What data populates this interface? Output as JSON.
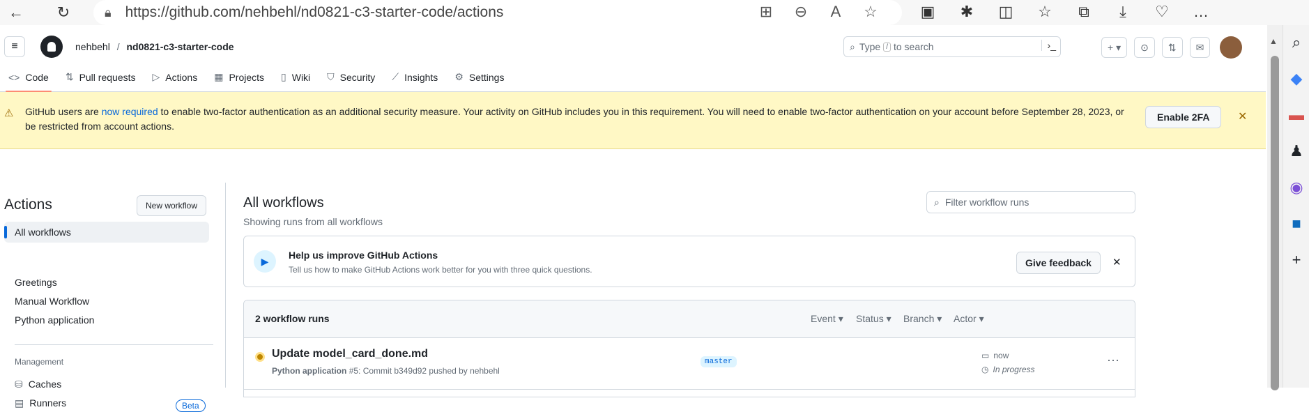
{
  "browser": {
    "url": "https://github.com/nehbehl/nd0821-c3-starter-code/actions"
  },
  "header": {
    "owner": "nehbehl",
    "separator": "/",
    "repo": "nd0821-c3-starter-code",
    "search_prefix": "Type",
    "search_key": "/",
    "search_suffix": "to search",
    "plus": "+ ▾"
  },
  "tabs": [
    {
      "label": "Code",
      "icon": "code-icon"
    },
    {
      "label": "Pull requests",
      "icon": "pull-request-icon"
    },
    {
      "label": "Actions",
      "icon": "play-icon"
    },
    {
      "label": "Projects",
      "icon": "table-icon"
    },
    {
      "label": "Wiki",
      "icon": "book-icon"
    },
    {
      "label": "Security",
      "icon": "shield-icon"
    },
    {
      "label": "Insights",
      "icon": "graph-icon"
    },
    {
      "label": "Settings",
      "icon": "gear-icon"
    }
  ],
  "banner": {
    "text_before": "GitHub users are ",
    "link": "now required",
    "text_after": " to enable two-factor authentication as an additional security measure. Your activity on GitHub includes you in this requirement. You will need to enable two-factor authentication on your account before September 28, 2023, or be restricted from account actions.",
    "button": "Enable 2FA"
  },
  "sidebar": {
    "title": "Actions",
    "new_workflow": "New workflow",
    "all_workflows": "All workflows",
    "workflows": [
      "Greetings",
      "Manual Workflow",
      "Python application"
    ],
    "management_heading": "Management",
    "caches": "Caches",
    "runners": "Runners",
    "runners_badge": "Beta"
  },
  "main": {
    "title": "All workflows",
    "subtitle": "Showing runs from all workflows",
    "filter_placeholder": "Filter workflow runs",
    "feedback": {
      "title": "Help us improve GitHub Actions",
      "desc": "Tell us how to make GitHub Actions work better for you with three quick questions.",
      "button": "Give feedback"
    },
    "runs": {
      "count": "2 workflow runs",
      "filters": [
        "Event ▾",
        "Status ▾",
        "Branch ▾",
        "Actor ▾"
      ],
      "items": [
        {
          "name": "Update model_card_done.md",
          "workflow": "Python application",
          "run": "#5: Commit b349d92 pushed by nehbehl",
          "branch": "master",
          "when": "now",
          "status": "In progress"
        }
      ]
    }
  }
}
